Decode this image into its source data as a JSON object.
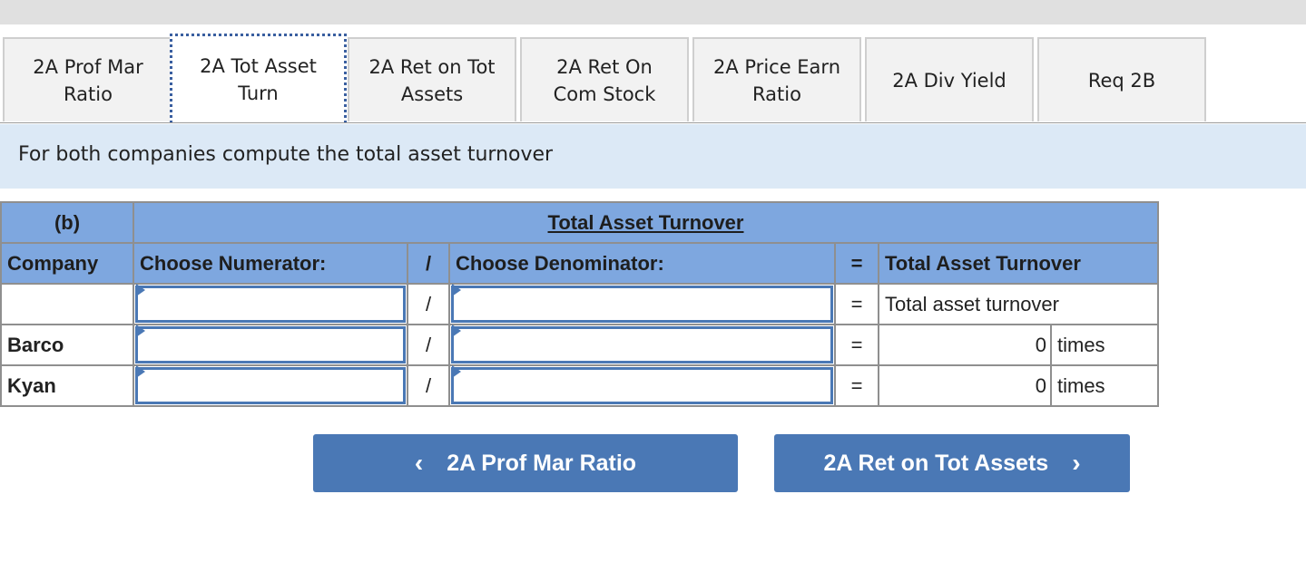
{
  "tabs": [
    {
      "label": "2A Prof Mar\nRatio",
      "active": false
    },
    {
      "label": "2A Tot Asset\nTurn",
      "active": true
    },
    {
      "label": "2A Ret on Tot\nAssets",
      "active": false
    },
    {
      "label": "2A Ret On\nCom Stock",
      "active": false
    },
    {
      "label": "2A Price Earn\nRatio",
      "active": false
    },
    {
      "label": "2A Div Yield",
      "active": false
    },
    {
      "label": "Req 2B",
      "active": false
    }
  ],
  "instruction": "For both companies compute the total asset turnover",
  "table": {
    "part_label": "(b)",
    "title": "Total Asset Turnover",
    "headers": {
      "company": "Company",
      "numerator": "Choose Numerator:",
      "divide": "/",
      "denominator": "Choose Denominator:",
      "equals": "=",
      "result": "Total Asset Turnover"
    },
    "rows": [
      {
        "company": "",
        "divide": "/",
        "equals": "=",
        "result_label": "Total asset turnover",
        "value": "",
        "unit": ""
      },
      {
        "company": "Barco",
        "divide": "/",
        "equals": "=",
        "result_label": "",
        "value": "0",
        "unit": "times"
      },
      {
        "company": "Kyan",
        "divide": "/",
        "equals": "=",
        "result_label": "",
        "value": "0",
        "unit": "times"
      }
    ]
  },
  "nav": {
    "prev_label": "2A Prof Mar Ratio",
    "next_label": "2A Ret on Tot Assets",
    "prev_icon": "chevron-left-icon",
    "next_icon": "chevron-right-icon"
  },
  "colors": {
    "accent": "#4a78b5",
    "header_bg": "#7ea7df",
    "prompt_bg": "#dce9f6",
    "tab_bg": "#f2f2f2"
  }
}
